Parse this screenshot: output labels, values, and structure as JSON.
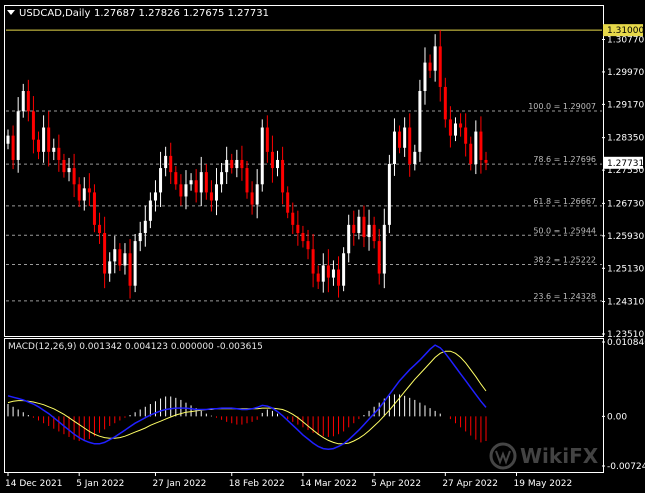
{
  "header": {
    "symbol": "USDCAD,Daily",
    "ohlc": "1.27687 1.27826 1.27675 1.27731"
  },
  "macd_label": "MACD(12,26,9) 0.001342 0.004123 0.000000 -0.003615",
  "watermark": "WikiFX",
  "colors": {
    "background": "#000000",
    "bull": "#ffffff",
    "bear": "#ff0000",
    "fib_line": "#9a9a9a",
    "macd_line": "#2020ff",
    "signal_line": "#ffff66",
    "resistance": "#e6d84a"
  },
  "chart_data": [
    {
      "type": "candlestick",
      "title": "USDCAD,Daily",
      "ylim": [
        1.2351,
        1.3125
      ],
      "y_ticks": [
        "1.30770",
        "1.29970",
        "1.29170",
        "1.28350",
        "1.27550",
        "1.26730",
        "1.25930",
        "1.25130",
        "1.24310",
        "1.23510"
      ],
      "x_ticks": [
        "14 Dec 2021",
        "5 Jan 2022",
        "27 Jan 2022",
        "18 Feb 2022",
        "14 Mar 2022",
        "5 Apr 2022",
        "27 Apr 2022",
        "19 May 2022"
      ],
      "price_labels": {
        "resistance": "1.31000",
        "current": "1.27731"
      },
      "fib_levels": [
        {
          "label": "100.0 = 1.29007",
          "value": 1.29007
        },
        {
          "label": "78.6 = 1.27696",
          "value": 1.27696
        },
        {
          "label": "61.8 = 1.26667",
          "value": 1.26667
        },
        {
          "label": "50.0 = 1.25944",
          "value": 1.25944
        },
        {
          "label": "38.2 = 1.25222",
          "value": 1.25222
        },
        {
          "label": "23.6 = 1.24328",
          "value": 1.24328
        }
      ],
      "resistance": 1.31,
      "closes": [
        1.284,
        1.278,
        1.29,
        1.295,
        1.29,
        1.283,
        1.28,
        1.286,
        1.28,
        1.281,
        1.278,
        1.275,
        1.276,
        1.272,
        1.268,
        1.271,
        1.27,
        1.262,
        1.26,
        1.25,
        1.253,
        1.256,
        1.252,
        1.255,
        1.247,
        1.258,
        1.26,
        1.263,
        1.268,
        1.27,
        1.276,
        1.279,
        1.275,
        1.272,
        1.269,
        1.272,
        1.273,
        1.27,
        1.275,
        1.27,
        1.268,
        1.272,
        1.275,
        1.278,
        1.276,
        1.278,
        1.276,
        1.27,
        1.267,
        1.272,
        1.286,
        1.28,
        1.276,
        1.278,
        1.27,
        1.265,
        1.262,
        1.26,
        1.258,
        1.256,
        1.25,
        1.248,
        1.252,
        1.249,
        1.251,
        1.247,
        1.255,
        1.262,
        1.26,
        1.264,
        1.259,
        1.262,
        1.258,
        1.25,
        1.262,
        1.277,
        1.285,
        1.281,
        1.286,
        1.277,
        1.28,
        1.295,
        1.302,
        1.3,
        1.306,
        1.296,
        1.288,
        1.284,
        1.287,
        1.286,
        1.282,
        1.277,
        1.285,
        1.278,
        1.2773
      ],
      "x_tick_index": [
        0,
        14,
        29,
        44,
        58,
        72,
        86,
        100
      ]
    },
    {
      "type": "histogram+line",
      "title": "MACD(12,26,9)",
      "ylim": [
        -0.00724,
        0.010846
      ],
      "y_ticks": [
        "0.010846",
        "0.00",
        "-0.00724"
      ],
      "histogram": [
        0.0018,
        0.0014,
        0.001,
        0.0006,
        0.0002,
        -0.0002,
        -0.0006,
        -0.001,
        -0.0014,
        -0.0018,
        -0.0022,
        -0.0026,
        -0.003,
        -0.0034,
        -0.0036,
        -0.0036,
        -0.0033,
        -0.0029,
        -0.0024,
        -0.0019,
        -0.0014,
        -0.001,
        -0.0006,
        -0.0002,
        0.0002,
        0.0006,
        0.001,
        0.0014,
        0.0018,
        0.0022,
        0.0026,
        0.0029,
        0.0029,
        0.0027,
        0.0024,
        0.002,
        0.0016,
        0.0012,
        0.0008,
        0.0004,
        0.0001,
        -0.0002,
        -0.0005,
        -0.0008,
        -0.001,
        -0.0012,
        -0.0012,
        -0.001,
        -0.0008,
        -0.0005,
        0.0005,
        0.001,
        0.0008,
        0.0004,
        0.0,
        -0.0004,
        -0.0008,
        -0.0012,
        -0.0016,
        -0.002,
        -0.0024,
        -0.0027,
        -0.0029,
        -0.003,
        -0.0029,
        -0.0026,
        -0.0022,
        -0.0016,
        -0.001,
        -0.0004,
        0.0002,
        0.0008,
        0.0014,
        0.002,
        0.0026,
        0.003,
        0.0032,
        0.0032,
        0.003,
        0.0027,
        0.0024,
        0.002,
        0.0016,
        0.0012,
        0.0008,
        0.0004,
        0.0,
        -0.0004,
        -0.001,
        -0.0016,
        -0.0022,
        -0.0028,
        -0.0034,
        -0.0038,
        -0.0036
      ],
      "macd_line": [
        0.003,
        0.0028,
        0.0026,
        0.0024,
        0.0021,
        0.0018,
        0.0014,
        0.0009,
        0.0004,
        -0.0002,
        -0.0008,
        -0.0014,
        -0.002,
        -0.0026,
        -0.0031,
        -0.0035,
        -0.0038,
        -0.004,
        -0.004,
        -0.0038,
        -0.0034,
        -0.003,
        -0.0025,
        -0.002,
        -0.0015,
        -0.001,
        -0.0006,
        -0.0002,
        0.0002,
        0.0005,
        0.0008,
        0.001,
        0.0011,
        0.0012,
        0.0012,
        0.0012,
        0.0011,
        0.001,
        0.001,
        0.001,
        0.0011,
        0.0011,
        0.0012,
        0.0012,
        0.0012,
        0.0011,
        0.001,
        0.001,
        0.0011,
        0.0013,
        0.0016,
        0.0015,
        0.0012,
        0.0007,
        0.0001,
        -0.0006,
        -0.0013,
        -0.002,
        -0.0027,
        -0.0033,
        -0.0039,
        -0.0044,
        -0.0047,
        -0.0048,
        -0.0047,
        -0.0044,
        -0.004,
        -0.0034,
        -0.0027,
        -0.002,
        -0.0012,
        -0.0004,
        0.0004,
        0.0012,
        0.0022,
        0.0032,
        0.0042,
        0.0052,
        0.006,
        0.0068,
        0.0075,
        0.0082,
        0.009,
        0.0098,
        0.0104,
        0.01,
        0.0092,
        0.0082,
        0.0072,
        0.0062,
        0.0052,
        0.0042,
        0.0032,
        0.0022,
        0.0013
      ],
      "signal_line": [
        0.002,
        0.0022,
        0.0023,
        0.0023,
        0.0022,
        0.0021,
        0.0019,
        0.0017,
        0.0014,
        0.0011,
        0.0007,
        0.0003,
        -0.0002,
        -0.0007,
        -0.0012,
        -0.0017,
        -0.0022,
        -0.0026,
        -0.0029,
        -0.0031,
        -0.0032,
        -0.0032,
        -0.0031,
        -0.0029,
        -0.0026,
        -0.0023,
        -0.002,
        -0.0017,
        -0.0013,
        -0.001,
        -0.0007,
        -0.0004,
        -0.0001,
        0.0002,
        0.0004,
        0.0006,
        0.0007,
        0.0008,
        0.0009,
        0.001,
        0.001,
        0.0011,
        0.0011,
        0.0011,
        0.0011,
        0.0011,
        0.0011,
        0.0011,
        0.0011,
        0.0011,
        0.0012,
        0.0012,
        0.0012,
        0.0011,
        0.001,
        0.0007,
        0.0003,
        -0.0002,
        -0.0008,
        -0.0014,
        -0.002,
        -0.0026,
        -0.0031,
        -0.0035,
        -0.0038,
        -0.004,
        -0.004,
        -0.0039,
        -0.0036,
        -0.0032,
        -0.0027,
        -0.0021,
        -0.0014,
        -0.0007,
        0.0001,
        0.0009,
        0.0018,
        0.0027,
        0.0036,
        0.0045,
        0.0054,
        0.0062,
        0.007,
        0.0078,
        0.0086,
        0.0092,
        0.0095,
        0.0095,
        0.0092,
        0.0086,
        0.0078,
        0.0068,
        0.0058,
        0.0047,
        0.0037
      ]
    }
  ]
}
